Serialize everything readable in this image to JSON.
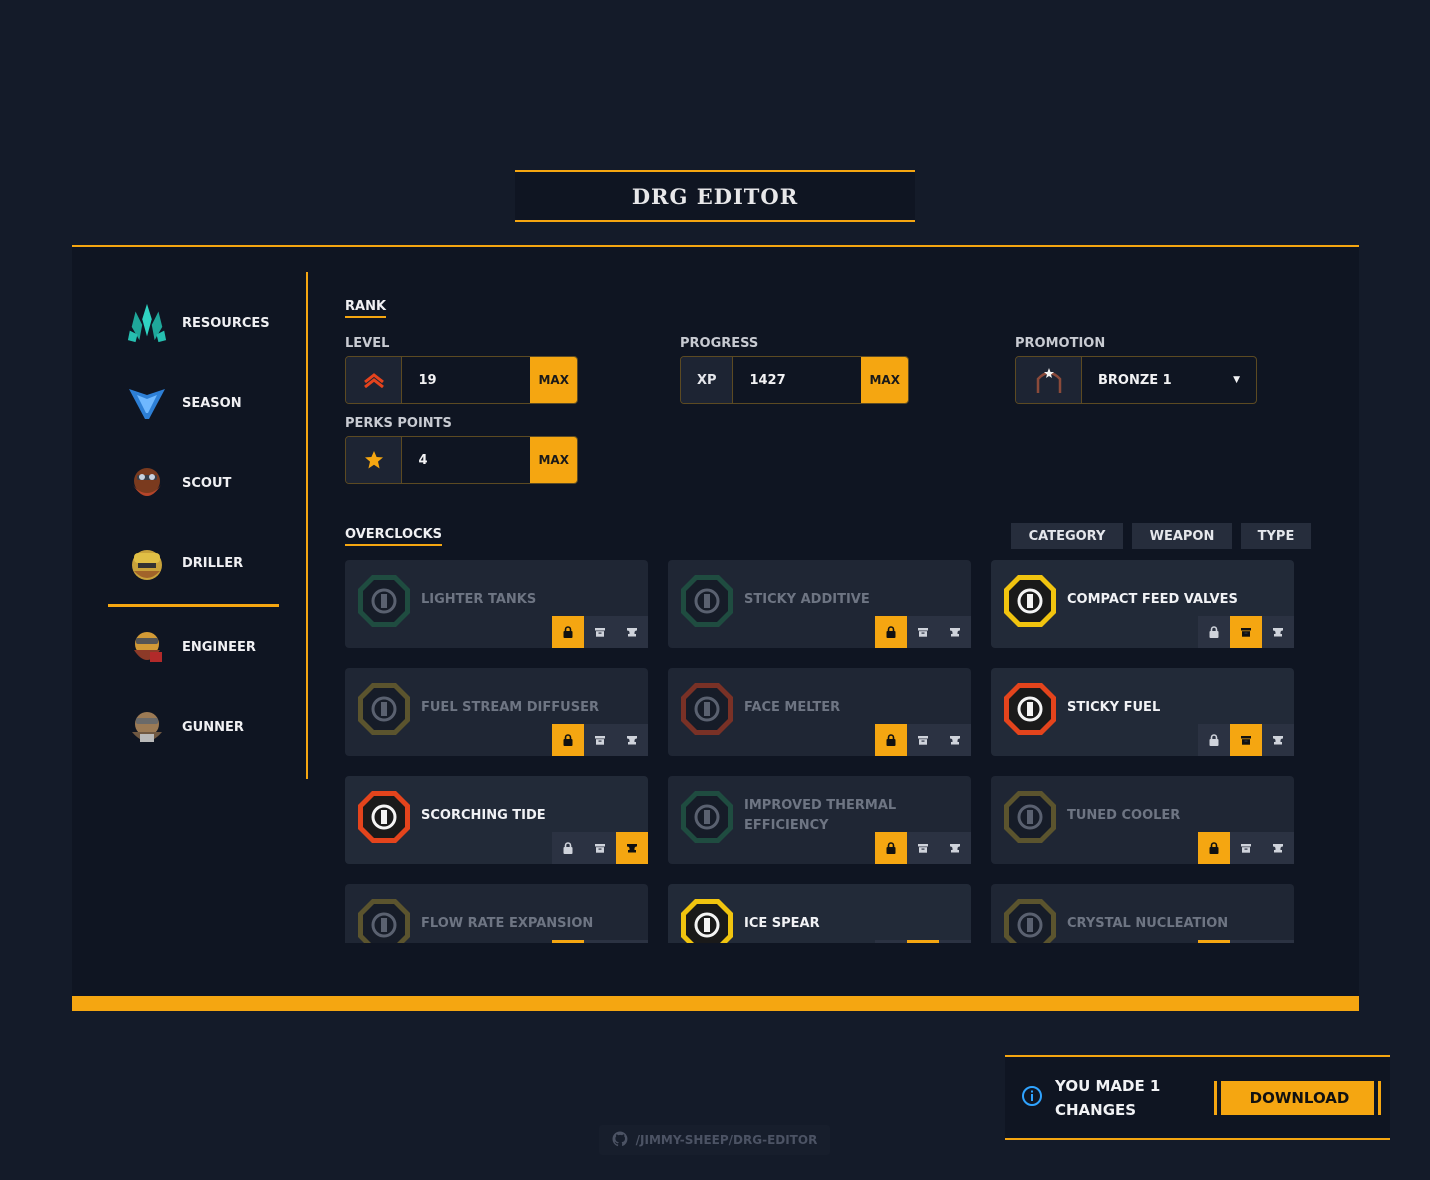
{
  "app": {
    "title": "DRG Editor"
  },
  "sidebar": {
    "items": [
      {
        "label": "RESOURCES",
        "icon": "crystal-icon"
      },
      {
        "label": "SEASON",
        "icon": "season-icon"
      },
      {
        "label": "SCOUT",
        "icon": "scout-icon"
      },
      {
        "label": "DRILLER",
        "icon": "driller-icon",
        "active": true
      },
      {
        "label": "ENGINEER",
        "icon": "engineer-icon"
      },
      {
        "label": "GUNNER",
        "icon": "gunner-icon"
      }
    ]
  },
  "rank": {
    "section_title": "RANK",
    "level": {
      "label": "LEVEL",
      "value": "19",
      "max_label": "MAX"
    },
    "progress": {
      "label": "PROGRESS",
      "prefix": "XP",
      "value": "1427",
      "max_label": "MAX"
    },
    "promotion": {
      "label": "PROMOTION",
      "value": "BRONZE 1"
    },
    "perks": {
      "label": "PERKS POINTS",
      "value": "4",
      "max_label": "MAX"
    }
  },
  "overclocks": {
    "section_title": "OVERCLOCKS",
    "filters": [
      "CATEGORY",
      "WEAPON",
      "TYPE"
    ],
    "items": [
      {
        "name": "LIGHTER TANKS",
        "state": "locked",
        "frame": "green"
      },
      {
        "name": "STICKY ADDITIVE",
        "state": "locked",
        "frame": "green"
      },
      {
        "name": "COMPACT FEED VALVES",
        "state": "unlocked",
        "frame": "gold"
      },
      {
        "name": "FUEL STREAM DIFFUSER",
        "state": "locked",
        "frame": "gold"
      },
      {
        "name": "FACE MELTER",
        "state": "locked",
        "frame": "red"
      },
      {
        "name": "STICKY FUEL",
        "state": "unlocked",
        "frame": "red"
      },
      {
        "name": "SCORCHING TIDE",
        "state": "forged",
        "frame": "red"
      },
      {
        "name": "IMPROVED THERMAL EFFICIENCY",
        "state": "locked",
        "frame": "green"
      },
      {
        "name": "TUNED COOLER",
        "state": "locked",
        "frame": "gold"
      },
      {
        "name": "FLOW RATE EXPANSION",
        "state": "locked",
        "frame": "gold"
      },
      {
        "name": "ICE SPEAR",
        "state": "unlocked",
        "frame": "gold"
      },
      {
        "name": "CRYSTAL NUCLEATION",
        "state": "locked",
        "frame": "gold"
      }
    ]
  },
  "notification": {
    "message": "YOU MADE 1 CHANGES",
    "download_label": "DOWNLOAD"
  },
  "footer": {
    "github_link": "/JIMMY-SHEEP/DRG-EDITOR"
  },
  "colors": {
    "accent": "#f5a611",
    "panel": "#0f1522",
    "background": "#141b29"
  }
}
